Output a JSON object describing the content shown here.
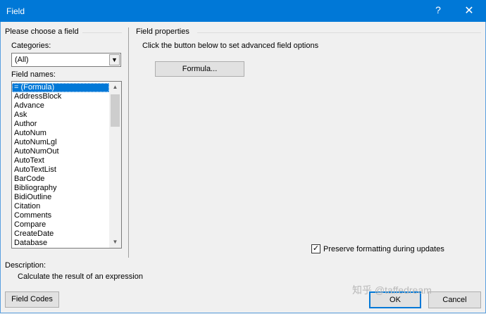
{
  "window": {
    "title": "Field",
    "help_glyph": "?",
    "close_glyph": "✕"
  },
  "left_panel": {
    "heading": "Please choose a field",
    "categories_label": "Categories:",
    "categories_value": "(All)",
    "field_names_label": "Field names:",
    "field_names": [
      "= (Formula)",
      "AddressBlock",
      "Advance",
      "Ask",
      "Author",
      "AutoNum",
      "AutoNumLgl",
      "AutoNumOut",
      "AutoText",
      "AutoTextList",
      "BarCode",
      "Bibliography",
      "BidiOutline",
      "Citation",
      "Comments",
      "Compare",
      "CreateDate",
      "Database"
    ],
    "selected_field": "= (Formula)"
  },
  "right_panel": {
    "heading": "Field properties",
    "instruction": "Click the button below to set advanced field options",
    "formula_button": "Formula...",
    "preserve_label": "Preserve formatting during updates",
    "preserve_checked": true
  },
  "description": {
    "label": "Description:",
    "text": "Calculate the result of an expression"
  },
  "footer": {
    "field_codes_button": "Field Codes",
    "ok_button": "OK",
    "cancel_button": "Cancel"
  },
  "watermark": "知乎 @taffedream",
  "colors": {
    "titlebar": "#0078d7",
    "selection": "#0078d7",
    "dialog_bg": "#f0f0f0"
  }
}
